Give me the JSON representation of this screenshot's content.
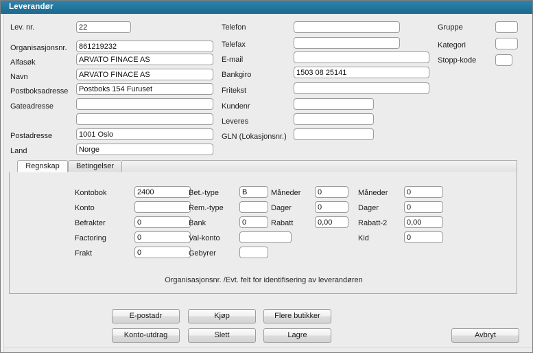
{
  "window": {
    "title": "Leverandør",
    "accent_color": "#25799f",
    "surface_color": "#ececec"
  },
  "form": {
    "left_column": [
      {
        "label": "Lev. nr.",
        "value": "22",
        "placeholder": ""
      },
      {
        "label": "Organisasjonsnr.",
        "value": "861219232",
        "placeholder": ""
      },
      {
        "label": "Alfasøk",
        "value": "ARVATO FINACE AS",
        "placeholder": ""
      },
      {
        "label": "Navn",
        "value": "ARVATO FINACE AS",
        "placeholder": ""
      },
      {
        "label": "Postboksadresse",
        "value": "Postboks 154 Furuset",
        "placeholder": ""
      },
      {
        "label": "Gateadresse",
        "value": "",
        "placeholder": ""
      },
      {
        "label": "",
        "value": "",
        "placeholder": ""
      },
      {
        "label": "Postadresse",
        "value": "1001 Oslo",
        "placeholder": ""
      },
      {
        "label": "Land",
        "value": "Norge",
        "placeholder": ""
      }
    ],
    "middle_column": [
      {
        "label": "Telefon",
        "value": "",
        "placeholder": ""
      },
      {
        "label": "Telefax",
        "value": "",
        "placeholder": ""
      },
      {
        "label": "E-mail",
        "value": "",
        "placeholder": ""
      },
      {
        "label": "Bankgiro",
        "value": "1503 08 25141",
        "placeholder": ""
      },
      {
        "label": "Fritekst",
        "value": "",
        "placeholder": ""
      },
      {
        "label": "Kundenr",
        "value": "",
        "placeholder": ""
      },
      {
        "label": "Leveres",
        "value": "",
        "placeholder": ""
      },
      {
        "label": "GLN (Lokasjonsnr.)",
        "value": "",
        "placeholder": ""
      }
    ],
    "right_column": [
      {
        "label": "Gruppe",
        "value": "",
        "placeholder": ""
      },
      {
        "label": "Kategori",
        "value": "",
        "placeholder": ""
      },
      {
        "label": "Stopp-kode",
        "value": "",
        "placeholder": ""
      }
    ]
  },
  "tabs": {
    "items": [
      {
        "label": "Regnskap",
        "active": true
      },
      {
        "label": "Betingelser",
        "active": false
      }
    ]
  },
  "tab_panel": {
    "col1": [
      {
        "label": "Kontobok",
        "value": "2400"
      },
      {
        "label": "Konto",
        "value": ""
      },
      {
        "label": "Befrakter",
        "value": "0"
      },
      {
        "label": "Factoring",
        "value": "0"
      },
      {
        "label": "Frakt",
        "value": "0"
      }
    ],
    "col2": [
      {
        "label": "Bet.-type",
        "value": "B"
      },
      {
        "label": "Rem.-type",
        "value": ""
      },
      {
        "label": "Bank",
        "value": "0"
      },
      {
        "label": "Val-konto",
        "value": ""
      },
      {
        "label": "Gebyrer",
        "value": ""
      }
    ],
    "col3": [
      {
        "label": "Måneder",
        "value": "0"
      },
      {
        "label": "Dager",
        "value": "0"
      },
      {
        "label": "Rabatt",
        "value": "0,00"
      }
    ],
    "col4": [
      {
        "label": "Måneder",
        "value": "0"
      },
      {
        "label": "Dager",
        "value": "0"
      },
      {
        "label": "Rabatt-2",
        "value": "0,00"
      },
      {
        "label": "Kid",
        "value": "0"
      }
    ],
    "note": "Organisasjonsnr. /Evt. felt for identifisering av leverandøren"
  },
  "buttons": {
    "row1": [
      {
        "label": "E-postadr"
      },
      {
        "label": "Kjøp"
      },
      {
        "label": "Flere butikker"
      }
    ],
    "row2": [
      {
        "label": "Konto-utdrag"
      },
      {
        "label": "Slett"
      },
      {
        "label": "Lagre"
      }
    ],
    "cancel": {
      "label": "Avbryt"
    }
  }
}
